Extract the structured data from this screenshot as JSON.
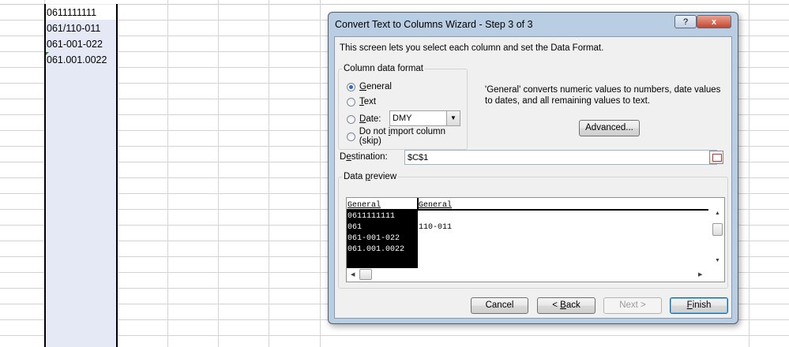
{
  "sheet": {
    "cells": [
      "0611111111",
      "061/110-011",
      "061-001-022",
      "061.001.0022"
    ]
  },
  "dialog": {
    "title": "Convert Text to Columns Wizard - Step 3 of 3",
    "help_label": "?",
    "close_label": "x",
    "description": "This screen lets you select each column and set the Data Format.",
    "column_format": {
      "legend": "Column data format",
      "options": [
        {
          "pre": "",
          "key": "G",
          "post": "eneral",
          "checked": true
        },
        {
          "pre": "",
          "key": "T",
          "post": "ext",
          "checked": false
        },
        {
          "pre": "",
          "key": "D",
          "post": "ate:",
          "checked": false
        },
        {
          "pre": "Do not ",
          "key": "i",
          "post": "mport column (skip)",
          "checked": false
        }
      ],
      "date_value": "DMY"
    },
    "explanation": "'General' converts numeric values to numbers, date values to dates, and all remaining values to text.",
    "advanced_label": "Advanced...",
    "destination": {
      "label_pre": "D",
      "label_key": "e",
      "label_post": "stination:",
      "value": "$C$1"
    },
    "preview": {
      "legend_pre": "Data ",
      "legend_key": "p",
      "legend_post": "review",
      "headers": [
        "General",
        "General"
      ],
      "col1": [
        "0611111111",
        "061",
        "061-001-022",
        "061.001.0022"
      ],
      "col2": [
        "",
        "110-011",
        "",
        ""
      ]
    },
    "buttons": {
      "cancel": "Cancel",
      "back_pre": "< ",
      "back_key": "B",
      "back_post": "ack",
      "next": "Next >",
      "finish_key": "F",
      "finish_post": "inish"
    }
  }
}
